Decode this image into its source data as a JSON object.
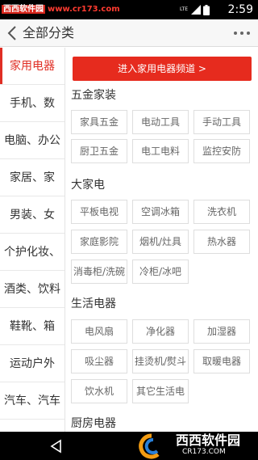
{
  "status_bar": {
    "watermark_brand": "西西软件园",
    "watermark_url": "www.cr173.com",
    "network_label": "LTE",
    "time": "2:59"
  },
  "header": {
    "title": "全部分类",
    "back_icon": "chevron-left-icon",
    "more_icon": "more-dots-icon"
  },
  "sidebar": {
    "active_index": 0,
    "items": [
      {
        "label": "家用电器"
      },
      {
        "label": "手机、数"
      },
      {
        "label": "电脑、办公"
      },
      {
        "label": "家居、家"
      },
      {
        "label": "男装、女"
      },
      {
        "label": "个护化妆、"
      },
      {
        "label": "酒类、饮料"
      },
      {
        "label": "鞋靴、箱"
      },
      {
        "label": "运动户外"
      },
      {
        "label": "汽车、汽车"
      }
    ]
  },
  "content": {
    "banner": "进入家用电器频道 >",
    "sections": [
      {
        "title": "五金家装",
        "items": [
          "家具五金",
          "电动工具",
          "手动工具",
          "厨卫五金",
          "电工电料",
          "监控安防"
        ]
      },
      {
        "title": "大家电",
        "items": [
          "平板电视",
          "空调冰箱",
          "洗衣机",
          "家庭影院",
          "烟机/灶具",
          "热水器",
          "消毒柜/洗碗",
          "冷柜/冰吧"
        ]
      },
      {
        "title": "生活电器",
        "items": [
          "电风扇",
          "净化器",
          "加湿器",
          "吸尘器",
          "挂烫机/熨斗",
          "取暖电器",
          "饮水机",
          "其它生活电"
        ]
      },
      {
        "title": "厨房电器",
        "items": []
      }
    ]
  },
  "navbar": {
    "back_icon": "triangle-back-icon",
    "logo_text": "西西软件园",
    "logo_url": "CR173.COM"
  },
  "colors": {
    "accent": "#e02e24",
    "banner_bg": "#e62b1e",
    "status_bar_bg": "#000000"
  }
}
